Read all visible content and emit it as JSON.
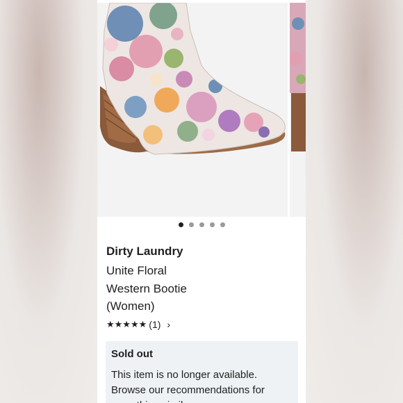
{
  "carousel": {
    "dots": [
      true,
      false,
      false,
      false,
      false
    ]
  },
  "product": {
    "brand": "Dirty Laundry",
    "name_lines": [
      "Unite Floral",
      "Western Bootie",
      "(Women)"
    ],
    "rating_stars": "★★★★★",
    "rating_count": "(1)",
    "chevron": "›"
  },
  "availability": {
    "title": "Sold out",
    "message": "This item is no longer available. Browse our recommendations for something similar."
  },
  "colors": {
    "text": "#1f1f1f",
    "box_bg": "#eef2f5",
    "dot_active": "#1f1f1f",
    "dot_inactive": "#9a9a9a"
  }
}
